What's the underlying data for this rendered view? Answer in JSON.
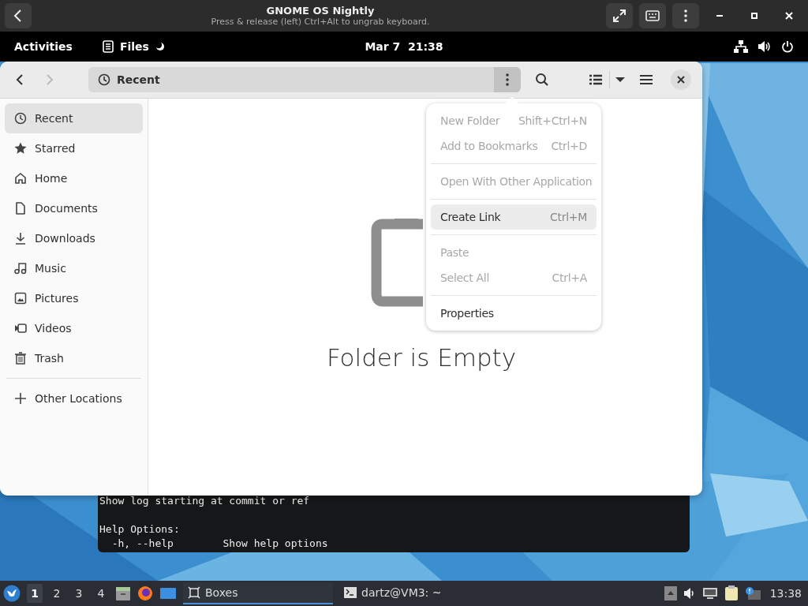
{
  "host_window": {
    "title": "GNOME OS Nightly",
    "subtitle": "Press & release (left) Ctrl+Alt to ungrab keyboard."
  },
  "top_bar": {
    "activities": "Activities",
    "app": "Files",
    "clock": "Mar 7  21:38"
  },
  "files": {
    "location": "Recent",
    "sidebar": [
      {
        "label": "Recent",
        "selected": true
      },
      {
        "label": "Starred",
        "selected": false
      },
      {
        "label": "Home",
        "selected": false
      },
      {
        "label": "Documents",
        "selected": false
      },
      {
        "label": "Downloads",
        "selected": false
      },
      {
        "label": "Music",
        "selected": false
      },
      {
        "label": "Pictures",
        "selected": false
      },
      {
        "label": "Videos",
        "selected": false
      },
      {
        "label": "Trash",
        "selected": false
      }
    ],
    "other_locations": "Other Locations",
    "empty_title": "Folder is Empty",
    "menu": [
      [
        {
          "label": "New Folder",
          "shortcut": "Shift+Ctrl+N",
          "disabled": true,
          "selected": false
        },
        {
          "label": "Add to Bookmarks",
          "shortcut": "Ctrl+D",
          "disabled": true,
          "selected": false
        }
      ],
      [
        {
          "label": "Open With Other Application",
          "disabled": true,
          "selected": false
        }
      ],
      [
        {
          "label": "Create Link",
          "shortcut": "Ctrl+M",
          "disabled": false,
          "selected": true
        }
      ],
      [
        {
          "label": "Paste",
          "disabled": true,
          "selected": false
        },
        {
          "label": "Select All",
          "shortcut": "Ctrl+A",
          "disabled": true,
          "selected": false
        }
      ],
      [
        {
          "label": "Properties",
          "disabled": false,
          "selected": false
        }
      ]
    ]
  },
  "terminal": {
    "blocks": [
      [
        "Show log starting at commit or ref"
      ],
      [
        "Help Options:",
        "  -h, --help        Show help options"
      ]
    ]
  },
  "taskbar": {
    "workspaces": [
      {
        "label": "1",
        "selected": true
      },
      {
        "label": "2",
        "selected": false
      },
      {
        "label": "3",
        "selected": false
      },
      {
        "label": "4",
        "selected": false
      }
    ],
    "tasks": [
      {
        "label": "Boxes",
        "kind": "boxes",
        "selected": true
      },
      {
        "label": "dartz@VM3: ~",
        "kind": "terminal",
        "selected": false
      }
    ],
    "clock": "13:38"
  }
}
